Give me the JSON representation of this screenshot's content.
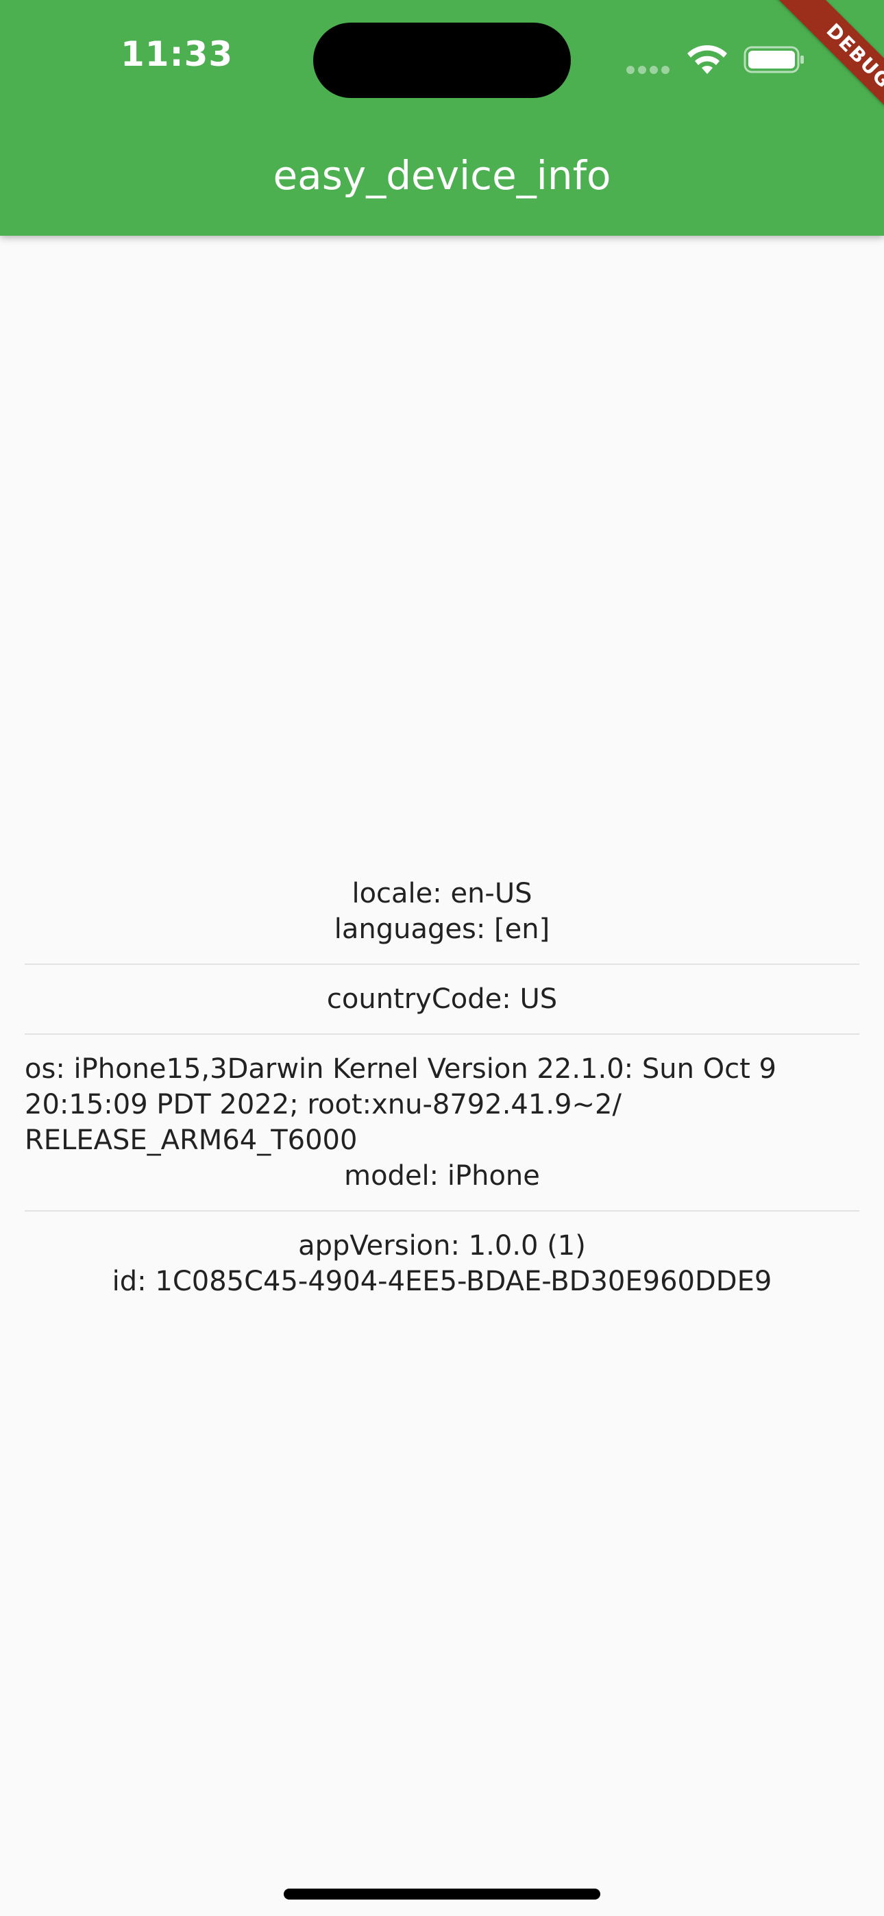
{
  "status_bar": {
    "time": "11:33"
  },
  "debug_banner": "DEBUG",
  "app_bar": {
    "title": "easy_device_info"
  },
  "info": {
    "locale": "locale:   en-US",
    "languages": "languages:   [en]",
    "country_code": "countryCode:   US",
    "os": "os:   iPhone15,3Darwin Kernel Version 22.1.0: Sun Oct  9 20:15:09 PDT 2022; root:xnu-8792.41.9~2/ RELEASE_ARM64_T6000",
    "model": "model:   iPhone",
    "app_version": "appVersion:   1.0.0 (1)",
    "id": "id:   1C085C45-4904-4EE5-BDAE-BD30E960DDE9"
  },
  "colors": {
    "app_bar": "#4caf50",
    "background": "#fafafa",
    "debug_ribbon": "#9c2f1c"
  },
  "icons": [
    "cellular-signal-icon",
    "wifi-icon",
    "battery-icon"
  ]
}
